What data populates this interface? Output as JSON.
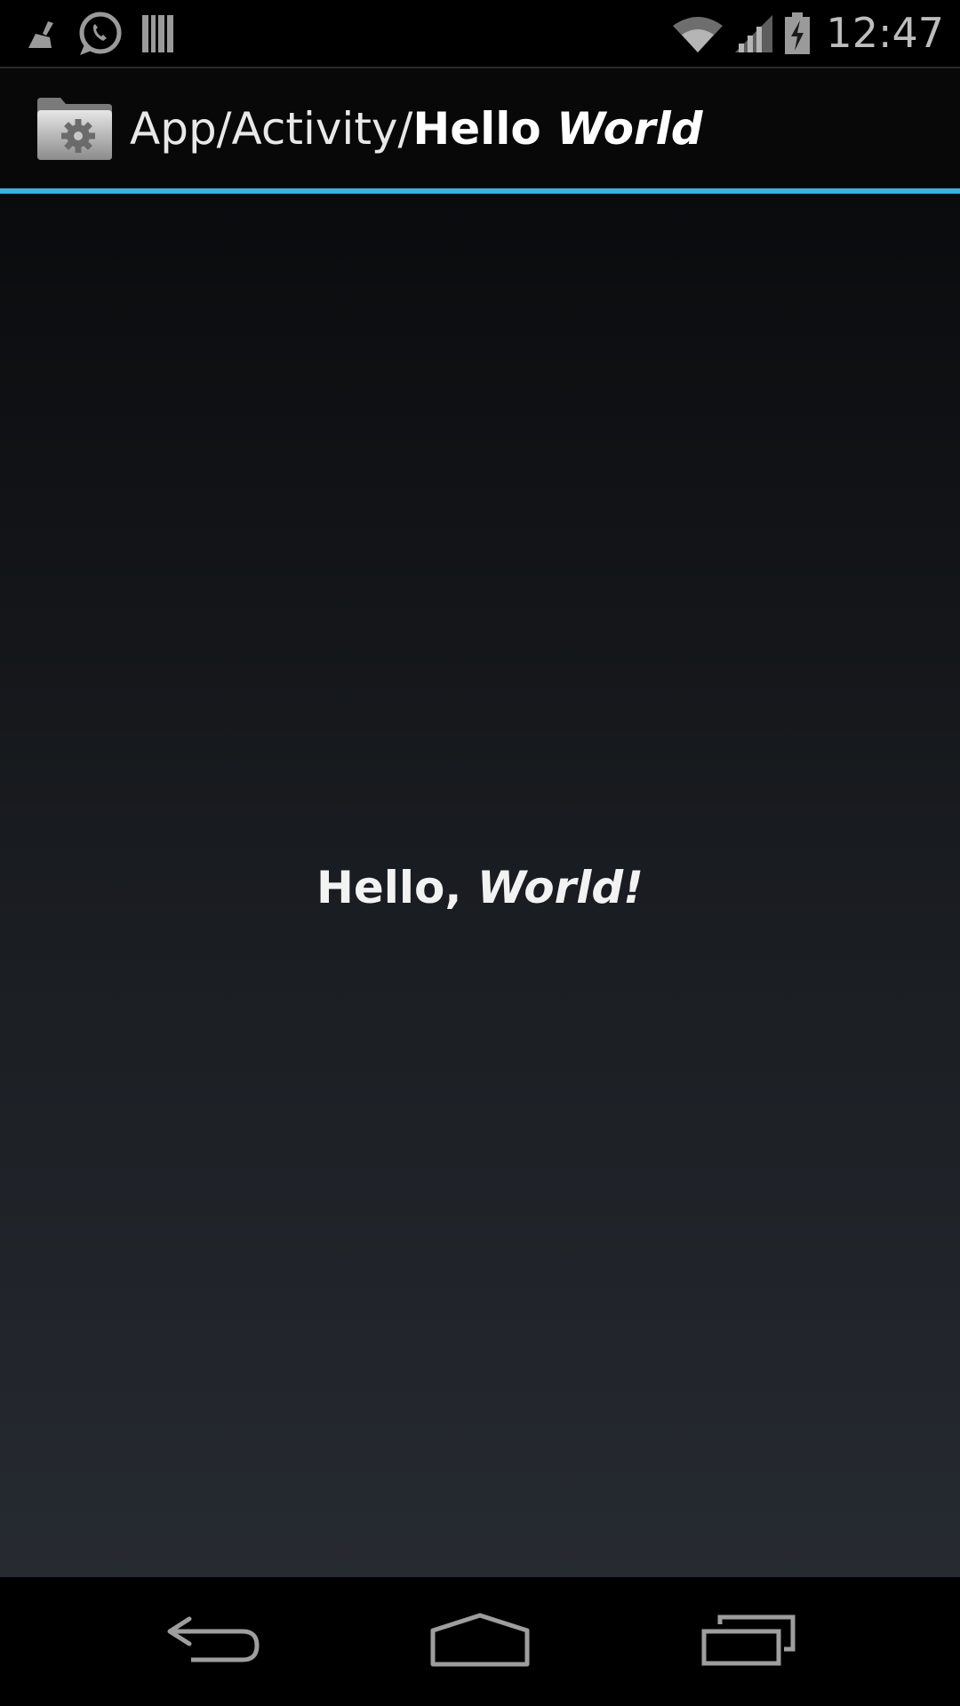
{
  "status_bar": {
    "time": "12:47",
    "left_icons": [
      "broom-icon",
      "whatsapp-icon",
      "barcode-icon"
    ],
    "right_icons": [
      "wifi-icon",
      "signal-icon",
      "battery-charging-icon"
    ]
  },
  "action_bar": {
    "title_prefix": "App/Activity/",
    "title_bold": "Hello ",
    "title_bold_italic": "World",
    "accent_color": "#33b5e5"
  },
  "content": {
    "greeting_bold": "Hello, ",
    "greeting_bold_italic": "World!"
  },
  "nav_bar": {
    "buttons": [
      "back-icon",
      "home-icon",
      "recent-apps-icon"
    ]
  }
}
